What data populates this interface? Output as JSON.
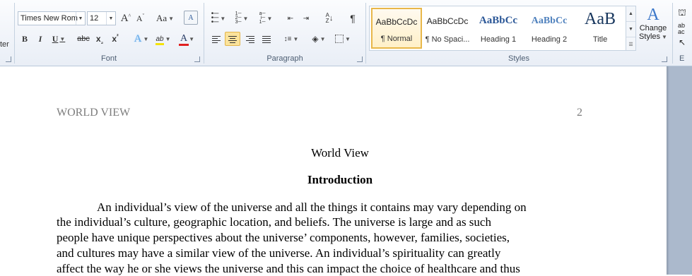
{
  "ribbon": {
    "clipboard": {
      "partial_label": "ter"
    },
    "font": {
      "label": "Font",
      "font_name": "Times New Rom",
      "font_size": "12",
      "grow_glyph": "A",
      "shrink_glyph": "A",
      "change_case": "Aa",
      "clear_format_glyph": "A",
      "bold": "B",
      "italic": "I",
      "underline": "U",
      "strikethrough": "abc",
      "subscript": "x",
      "superscript": "x",
      "text_effects": "A",
      "highlight": "ab",
      "font_color": "A",
      "font_color_hex": "#e02020",
      "highlight_hex": "#f5e30a"
    },
    "paragraph": {
      "label": "Paragraph",
      "show_marks": "¶"
    },
    "styles": {
      "label": "Styles",
      "tiles": [
        {
          "sample": "AaBbCcDc",
          "name": "¶ Normal",
          "active": true
        },
        {
          "sample": "AaBbCcDc",
          "name": "¶ No Spaci...",
          "active": false
        },
        {
          "sample": "AaBbCc",
          "name": "Heading 1",
          "active": false
        },
        {
          "sample": "AaBbCc",
          "name": "Heading 2",
          "active": false
        },
        {
          "sample": "AaB",
          "name": "Title",
          "active": false
        }
      ],
      "change_styles_line1": "Change",
      "change_styles_line2": "Styles",
      "heading_color_hex": "#2b5797"
    },
    "editing": {
      "partial_label": "E"
    }
  },
  "document": {
    "header": "WORLD VIEW",
    "page_number": "2",
    "title": "World View",
    "heading": "Introduction",
    "lines": [
      "An individual’s view of the universe and all the things it contains may vary depending on",
      "the individual’s culture, geographic location, and beliefs. The universe is large and as such",
      "people have unique perspectives about the universe’ components, however, families, societies,",
      "and cultures may have a similar view of the universe. An individual’s spirituality can greatly",
      "affect the way he or she views the universe and this can impact the choice of healthcare and thus"
    ]
  }
}
